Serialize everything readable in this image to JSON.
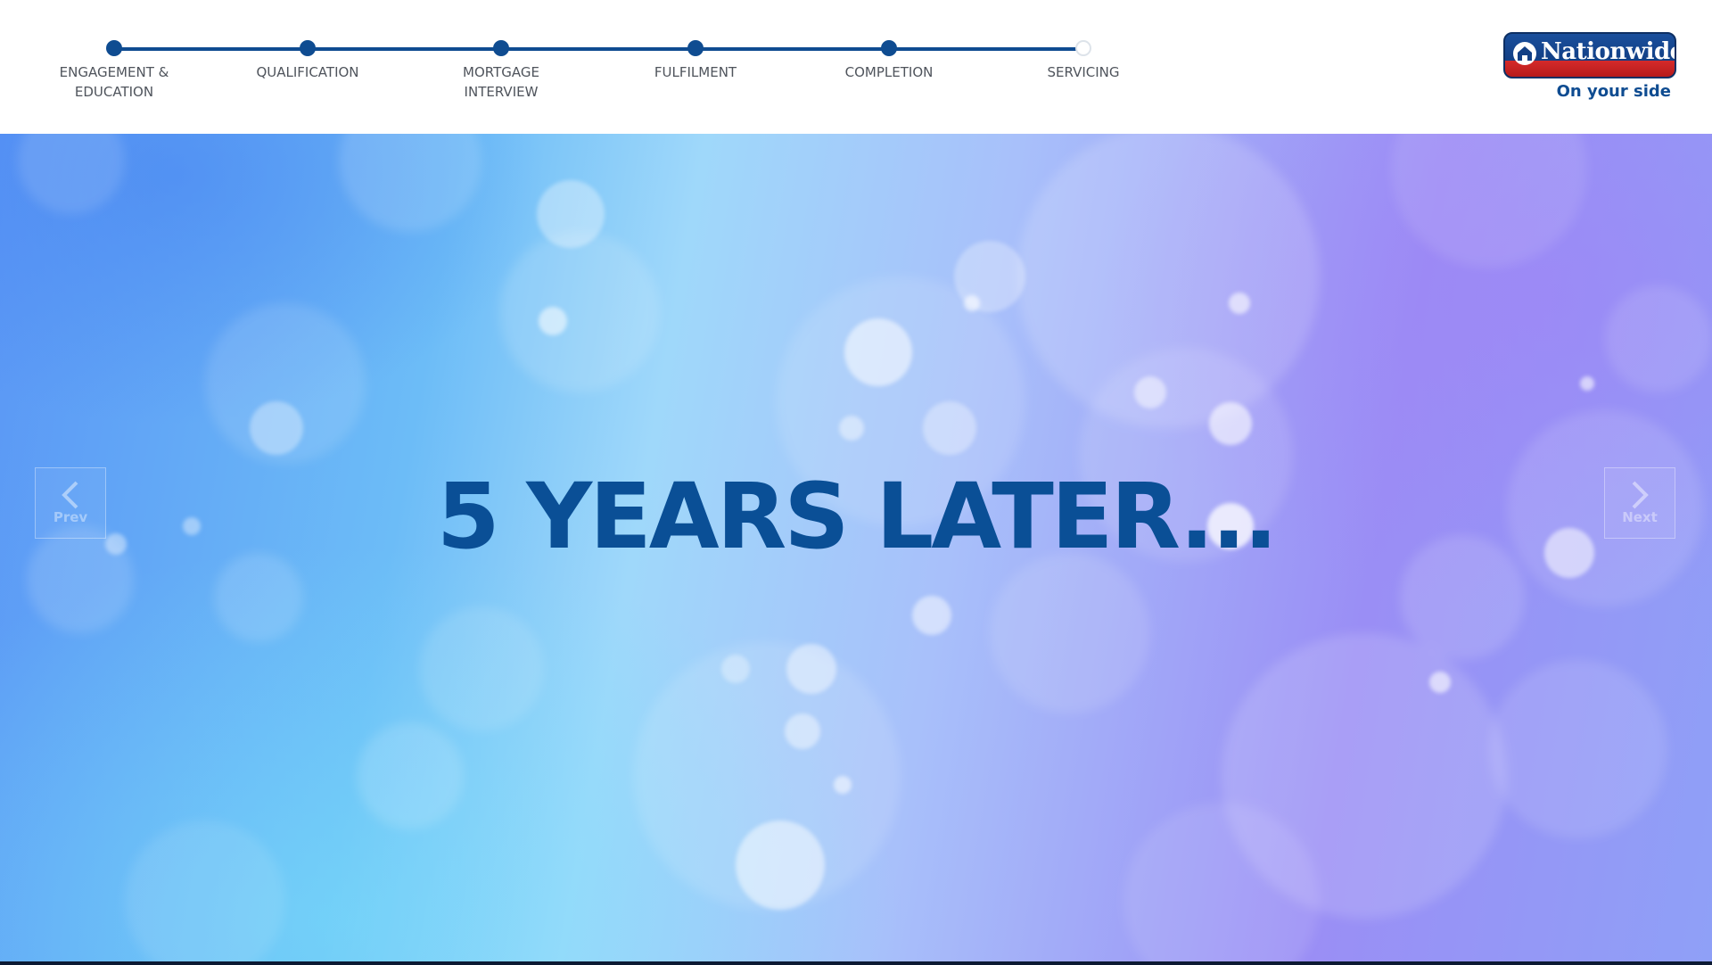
{
  "progress": {
    "steps": [
      {
        "label_line1": "ENGAGEMENT &",
        "label_line2": "EDUCATION",
        "state": "complete"
      },
      {
        "label_line1": "QUALIFICATION",
        "label_line2": "",
        "state": "complete"
      },
      {
        "label_line1": "MORTGAGE",
        "label_line2": "INTERVIEW",
        "state": "complete"
      },
      {
        "label_line1": "FULFILMENT",
        "label_line2": "",
        "state": "complete"
      },
      {
        "label_line1": "COMPLETION",
        "label_line2": "",
        "state": "complete"
      },
      {
        "label_line1": "SERVICING",
        "label_line2": "",
        "state": "pending"
      }
    ],
    "active_color": "#0f4c91"
  },
  "brand": {
    "name": "Nationwide",
    "tagline": "On your side",
    "primary_color": "#123f85",
    "accent_color": "#d52b2b"
  },
  "hero": {
    "title": "5 YEARS LATER...",
    "title_color": "#0a4f96"
  },
  "nav": {
    "prev_label": "Prev",
    "next_label": "Next",
    "prev_icon": "chevron-left-icon",
    "next_icon": "chevron-right-icon"
  }
}
